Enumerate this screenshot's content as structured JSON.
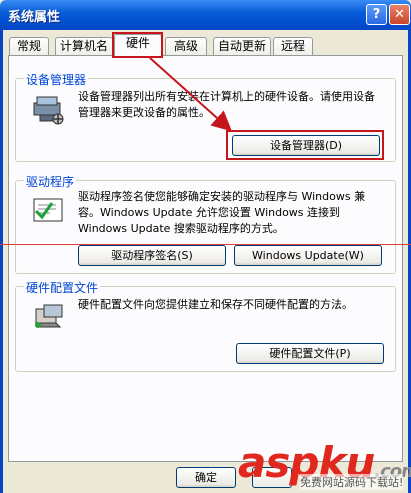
{
  "window": {
    "title": "系统属性",
    "help_label": "?",
    "close_label": "✕"
  },
  "tabs": [
    {
      "label": "常规"
    },
    {
      "label": "计算机名"
    },
    {
      "label": "硬件"
    },
    {
      "label": "高级"
    },
    {
      "label": "自动更新"
    },
    {
      "label": "远程"
    }
  ],
  "device_manager": {
    "title": "设备管理器",
    "description": "设备管理器列出所有安装在计算机上的硬件设备。请使用设备管理器来更改设备的属性。",
    "button": "设备管理器(D)"
  },
  "drivers": {
    "title": "驱动程序",
    "description": "驱动程序签名使您能够确定安装的驱动程序与 Windows 兼容。Windows Update 允许您设置 Windows 连接到 Windows Update 搜索驱动程序的方式。",
    "signing_button": "驱动程序签名(S)",
    "update_button": "Windows Update(W)"
  },
  "hardware_profiles": {
    "title": "硬件配置文件",
    "description": "硬件配置文件向您提供建立和保存不同硬件配置的方法。",
    "button": "硬件配置文件(P)"
  },
  "footer": {
    "ok_label": "确定"
  },
  "watermark": {
    "brand": "aspku",
    "suffix": ".com",
    "sub": "免费网站源码下载站!"
  },
  "colors": {
    "accent": "#0046d5",
    "highlight": "#c4161c"
  }
}
